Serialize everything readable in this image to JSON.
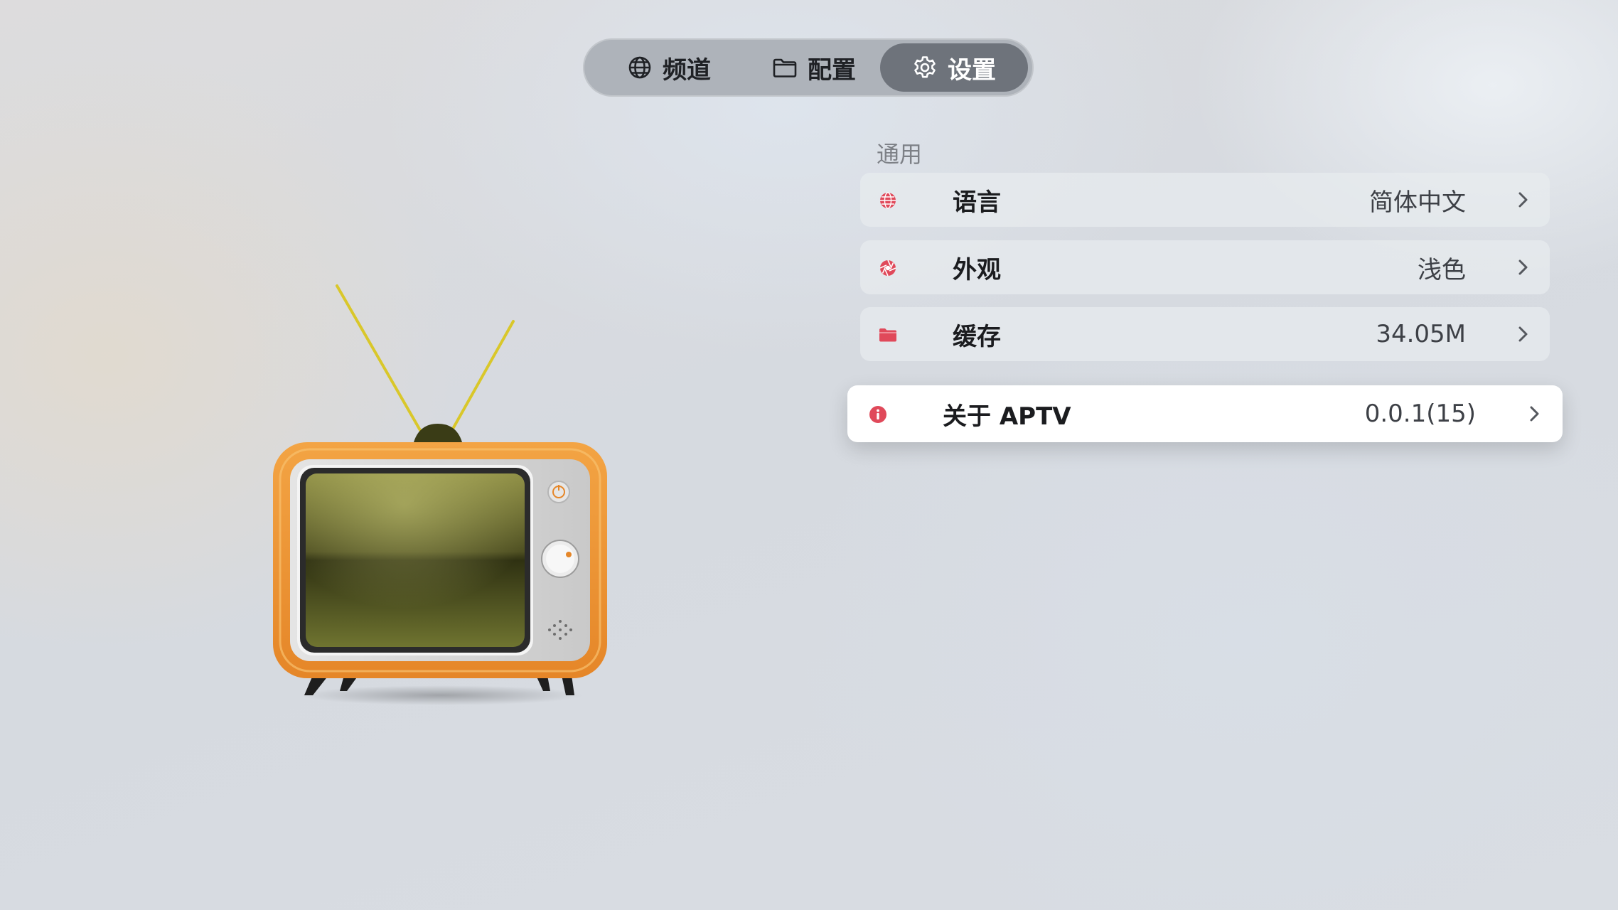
{
  "tabs": [
    {
      "label": "频道",
      "icon": "globe-icon"
    },
    {
      "label": "配置",
      "icon": "folder-icon"
    },
    {
      "label": "设置",
      "icon": "gear-icon",
      "selected": true
    }
  ],
  "settings": {
    "section_title": "通用",
    "rows": [
      {
        "label": "语言",
        "value": "简体中文",
        "icon": "globe-icon"
      },
      {
        "label": "外观",
        "value": "浅色",
        "icon": "aperture-icon"
      },
      {
        "label": "缓存",
        "value": "34.05M",
        "icon": "folder-icon"
      },
      {
        "label": "关于 APTV",
        "value": "0.0.1(15)",
        "icon": "info-icon",
        "focused": true
      }
    ]
  },
  "colors": {
    "accent_red": "#e0495a",
    "tab_selected_bg": "#6e737b",
    "tab_bar_bg": "#aeb3ba",
    "tv_body": "#ef9a3a"
  }
}
